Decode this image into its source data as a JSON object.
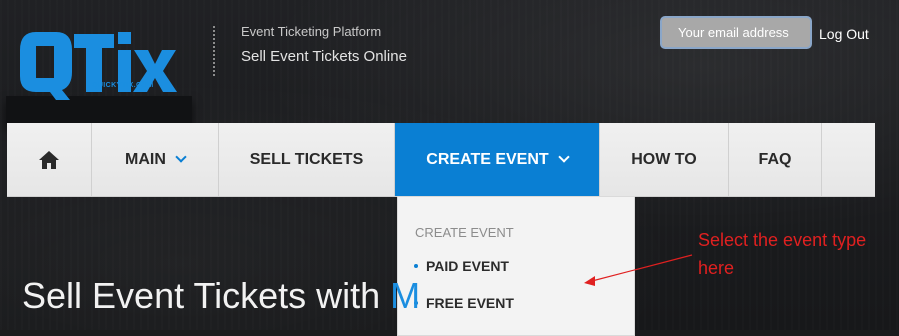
{
  "brand": {
    "logo_text": "QTix",
    "logo_url_text": "QUICKYTIX.COM",
    "accent_color": "#1b8ee0"
  },
  "header": {
    "tagline_small": "Event Ticketing Platform",
    "tagline_large": "Sell Event Tickets Online",
    "email_placeholder": "Your email address",
    "logout_label": "Log Out"
  },
  "nav": {
    "home_icon": "home-icon",
    "items": [
      {
        "label": "MAIN",
        "has_dropdown": true
      },
      {
        "label": "SELL TICKETS",
        "has_dropdown": false
      },
      {
        "label": "CREATE EVENT",
        "has_dropdown": true,
        "active": true
      },
      {
        "label": "HOW TO",
        "has_dropdown": false
      },
      {
        "label": "FAQ",
        "has_dropdown": false
      }
    ],
    "active_color": "#0a7fd3"
  },
  "dropdown": {
    "header": "CREATE EVENT",
    "items": [
      {
        "label": "PAID EVENT"
      },
      {
        "label": "FREE EVENT"
      }
    ]
  },
  "annotation": {
    "text": "Select the event type here",
    "color": "#e02020"
  },
  "hero": {
    "title": "Sell Event Tickets with ",
    "title_accent": "M"
  }
}
